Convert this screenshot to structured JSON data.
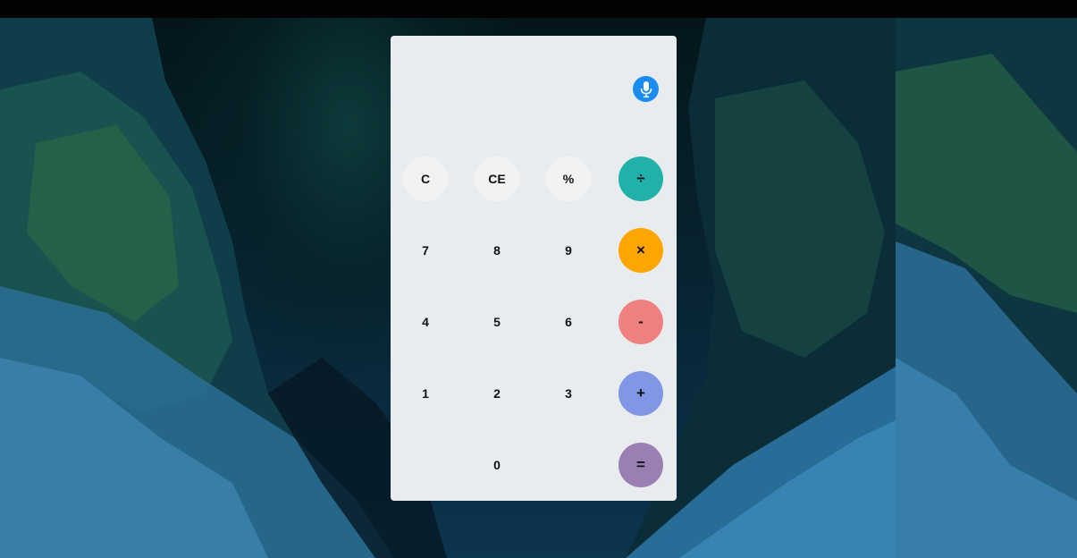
{
  "calculator": {
    "display_value": "",
    "mic_icon": "microphone-icon",
    "accent_color": "#1a8cf0",
    "function_keys": {
      "clear": "C",
      "clear_entry": "CE",
      "percent": "%"
    },
    "digits": {
      "d0": "0",
      "d1": "1",
      "d2": "2",
      "d3": "3",
      "d4": "4",
      "d5": "5",
      "d6": "6",
      "d7": "7",
      "d8": "8",
      "d9": "9"
    },
    "operators": {
      "divide": "÷",
      "multiply": "×",
      "subtract": "-",
      "add": "+",
      "equals": "="
    },
    "operator_colors": {
      "divide": "#20b2aa",
      "multiply": "#ffa500",
      "subtract": "#f08080",
      "add": "#8196e4",
      "equals": "#9a7fb4"
    }
  }
}
